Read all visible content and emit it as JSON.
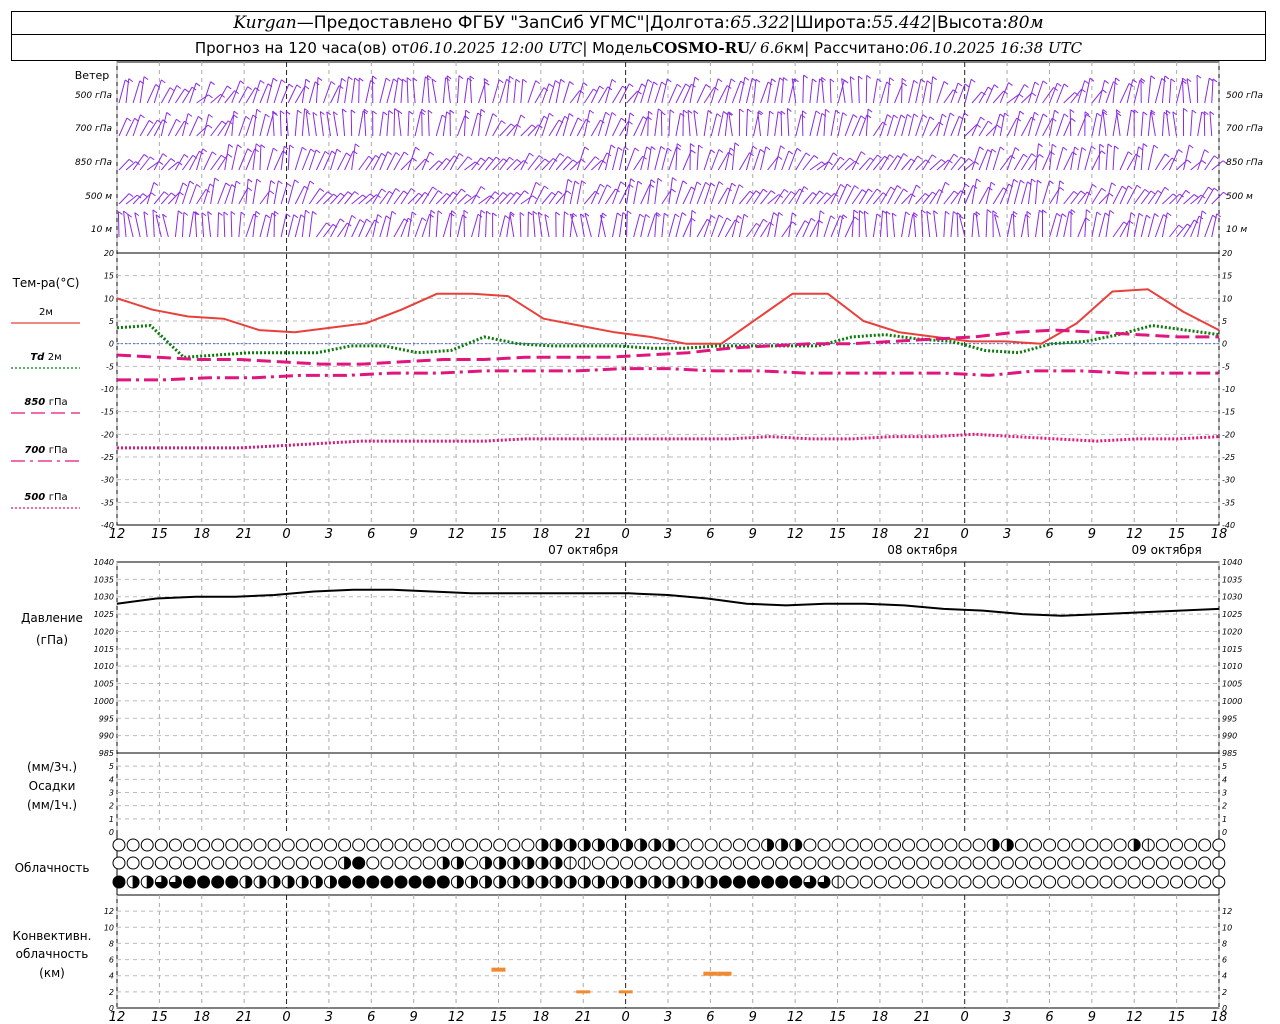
{
  "header": {
    "station": "Kurgan",
    "dash": " — ",
    "provider": "Предоставлено ФГБУ \"ЗапСиб УГМС\"",
    "sep": " | ",
    "lon_label": "Долгота: ",
    "lon_value": "65.322",
    "lat_label": "Широта: ",
    "lat_value": "55.442",
    "alt_label": "Высота: ",
    "alt_value": "80м",
    "forecast_label": "Прогноз на 120 часа(ов) от ",
    "forecast_time": "06.10.2025 12:00 UTC",
    "model_label": " | Модель ",
    "model_name": "COSMO-RU",
    "model_res": " / 6.6",
    "model_res_unit": "км",
    "calc_label": " | Рассчитано: ",
    "calc_time": "06.10.2025 16:38 UTC"
  },
  "wind_panel": {
    "title": "Ветер",
    "levels": [
      "500 гПа",
      "700 гПа",
      "850 гПа",
      "500 м",
      "10 м"
    ],
    "color": "#8a2be2"
  },
  "temp_panel": {
    "title": "Тем-ра(°С)",
    "legend": [
      {
        "label": "2м",
        "italic_prefix": "",
        "color": "#e8403a",
        "style": "solid"
      },
      {
        "label": "2м",
        "italic_prefix": "Td",
        "color": "#0a7a0a",
        "style": "dotted"
      },
      {
        "label": "гПа",
        "italic_prefix": "850",
        "color": "#e0157e",
        "style": "dashed"
      },
      {
        "label": "гПа",
        "italic_prefix": "700",
        "color": "#e0157e",
        "style": "dashdot"
      },
      {
        "label": "гПа",
        "italic_prefix": "500",
        "color": "#e0157e",
        "style": "dotted"
      }
    ],
    "yticks": [
      "20",
      "15",
      "10",
      "5",
      "0",
      "-5",
      "-10",
      "-15",
      "-20",
      "-25",
      "-30",
      "-35",
      "-40"
    ]
  },
  "pressure_panel": {
    "title1": "Давление",
    "title2": "(гПа)",
    "yticks": [
      "1040",
      "1035",
      "1030",
      "1025",
      "1020",
      "1015",
      "1010",
      "1005",
      "1000",
      "995",
      "990",
      "985"
    ]
  },
  "precip_panel": {
    "title1": "(мм/3ч.)",
    "title2": "Осадки",
    "title3": "(мм/1ч.)",
    "yticks": [
      "5",
      "4",
      "3",
      "2",
      "1",
      "0"
    ]
  },
  "cloud_panel": {
    "title": "Облачность"
  },
  "conv_panel": {
    "title1": "Конвективн.",
    "title2": "облачность",
    "title3": "(км)",
    "yticks": [
      "12",
      "10",
      "8",
      "6",
      "4",
      "2",
      "0"
    ],
    "color": "#f08a30"
  },
  "time_axis": {
    "hour_labels": [
      "12",
      "15",
      "18",
      "21",
      "0",
      "3",
      "6",
      "9",
      "12",
      "15",
      "18",
      "21",
      "0",
      "3",
      "6",
      "9",
      "12",
      "15",
      "18",
      "21",
      "0",
      "3",
      "6",
      "9",
      "12",
      "15",
      "18"
    ],
    "day_labels": [
      "07 октября",
      "08 октября",
      "09 октября"
    ]
  },
  "chart_data": {
    "type": "line",
    "x_hours_from_start": [
      0,
      3,
      6,
      9,
      12,
      15,
      18,
      21,
      24,
      27,
      30,
      33,
      36,
      39,
      42,
      45,
      48,
      51,
      54,
      57,
      60,
      63,
      66,
      69,
      72,
      75,
      78
    ],
    "series": [
      {
        "name": "2м",
        "values": [
          10,
          7.5,
          6,
          5.5,
          3,
          2.5,
          3.5,
          4.5,
          7.5,
          11,
          11,
          10.5,
          5.5,
          4,
          2.5,
          1.5,
          0,
          0,
          5.5,
          11,
          11,
          5,
          2.5,
          1.5,
          0.5,
          0.5,
          0,
          4.5,
          11.5,
          12,
          7,
          3
        ]
      },
      {
        "name": "Td 2м",
        "values": [
          3.5,
          4,
          -3,
          -2.5,
          -2,
          -2,
          -2,
          -0.5,
          -0.5,
          -2,
          -1.5,
          1.5,
          0,
          -0.5,
          -0.5,
          -0.5,
          -1,
          -1,
          -0.5,
          -0.5,
          -0.5,
          -0.5,
          1.5,
          2,
          1,
          0.5,
          -1.5,
          -2,
          0,
          0.5,
          2,
          4,
          3,
          2
        ]
      },
      {
        "name": "850 гПа",
        "values": [
          -2.5,
          -3,
          -3.5,
          -3.5,
          -4,
          -4.5,
          -4.5,
          -4,
          -3.5,
          -3.5,
          -3,
          -3,
          -3,
          -2.5,
          -2,
          -1,
          -0.5,
          0,
          0,
          0.5,
          1,
          1.5,
          2.5,
          3,
          2.5,
          2,
          1.5,
          1.5
        ]
      },
      {
        "name": "700 гПа",
        "values": [
          -8,
          -8,
          -7.5,
          -7.5,
          -7,
          -7,
          -6.5,
          -6.5,
          -6,
          -6,
          -6,
          -5.5,
          -5.5,
          -6,
          -6,
          -6.5,
          -6.5,
          -6.5,
          -6.5,
          -7,
          -6,
          -6,
          -6.5,
          -6.5,
          -6.5
        ]
      },
      {
        "name": "500 гПа",
        "values": [
          -23,
          -23,
          -23,
          -23,
          -22.5,
          -22,
          -21.5,
          -21.5,
          -21.5,
          -21.5,
          -21,
          -21,
          -21,
          -21,
          -21,
          -21,
          -20.5,
          -21,
          -21,
          -20.5,
          -20.5,
          -20,
          -20.5,
          -21,
          -21.5,
          -21,
          -21,
          -20.5
        ]
      }
    ],
    "pressure": {
      "name": "Давление",
      "values": [
        1028,
        1029.5,
        1030,
        1030,
        1030.5,
        1031.5,
        1032,
        1032,
        1031.5,
        1031,
        1031,
        1031,
        1031,
        1031,
        1030.5,
        1029.5,
        1028,
        1027.5,
        1028,
        1028,
        1027.5,
        1026.5,
        1026,
        1025,
        1024.5,
        1025,
        1025.5,
        1026,
        1026.5
      ]
    },
    "convective_cloud_km": [
      {
        "hour": 27,
        "base": 4.5,
        "top": 5.0
      },
      {
        "hour": 33,
        "base": 2.0,
        "top": 2.0
      },
      {
        "hour": 36,
        "base": 2.0,
        "top": 2.0
      },
      {
        "hour": 42,
        "base": 4.0,
        "top": 4.5
      },
      {
        "hour": 43,
        "base": 4.0,
        "top": 4.5
      }
    ],
    "cloud_cover_eighths": {
      "upper": [
        0,
        0,
        0,
        0,
        0,
        0,
        0,
        0,
        0,
        0,
        0,
        0,
        0,
        0,
        0,
        0,
        0,
        0,
        0,
        0,
        0,
        0,
        0,
        0,
        0,
        0,
        0,
        0,
        0,
        0,
        4,
        4,
        4,
        4,
        4,
        4,
        4,
        4,
        4,
        4,
        0,
        0,
        0,
        0,
        0,
        0,
        4,
        4,
        4,
        0,
        0,
        0,
        0,
        0,
        0,
        0,
        0,
        0,
        0,
        0,
        0,
        0,
        4,
        4,
        0,
        0,
        0,
        0,
        0,
        0,
        0,
        0,
        4,
        2,
        0,
        0,
        0,
        0,
        0,
        0,
        4,
        4,
        0,
        0,
        0,
        0,
        0,
        0,
        0,
        0,
        0,
        0,
        0,
        0,
        0,
        0,
        0,
        0,
        0,
        0,
        0,
        0,
        0,
        0,
        0,
        0,
        0,
        0,
        0,
        0,
        4,
        4,
        4,
        4,
        4,
        4,
        2,
        0
      ],
      "middle": [
        0,
        0,
        0,
        0,
        0,
        0,
        0,
        0,
        0,
        0,
        0,
        0,
        0,
        0,
        0,
        0,
        4,
        8,
        0,
        0,
        0,
        0,
        0,
        4,
        4,
        0,
        4,
        4,
        4,
        4,
        4,
        4,
        2,
        2,
        0,
        0,
        0,
        0,
        0,
        0,
        0,
        0,
        0,
        0,
        0,
        0,
        0,
        0,
        0,
        0,
        0,
        0,
        0,
        0,
        0,
        0,
        0,
        0,
        0,
        0,
        0,
        0,
        0,
        0,
        0,
        0,
        0,
        0,
        0,
        0,
        0,
        0,
        0,
        0,
        0,
        0,
        0,
        0,
        0,
        0,
        0,
        0,
        0,
        0,
        0,
        0,
        0,
        0,
        0,
        0,
        0,
        0,
        0,
        0,
        0,
        0,
        0,
        0,
        0,
        0,
        0,
        0,
        0,
        0,
        0,
        0,
        4,
        4,
        2,
        2,
        4,
        4,
        4,
        6,
        8,
        8,
        8
      ],
      "lower": [
        8,
        4,
        4,
        6,
        6,
        8,
        8,
        8,
        8,
        4,
        4,
        4,
        4,
        4,
        4,
        4,
        8,
        8,
        8,
        8,
        8,
        8,
        8,
        8,
        4,
        4,
        4,
        4,
        4,
        4,
        4,
        4,
        4,
        4,
        4,
        4,
        4,
        4,
        4,
        4,
        4,
        4,
        4,
        8,
        8,
        8,
        8,
        8,
        8,
        6,
        6,
        2,
        0,
        0,
        0,
        0,
        0,
        0,
        0,
        0,
        0,
        0,
        0,
        0,
        0,
        0,
        0,
        0,
        0,
        0,
        0,
        0,
        0,
        0,
        0,
        0,
        0,
        0,
        0,
        0,
        0,
        0,
        0,
        0,
        0,
        0,
        0,
        0,
        0,
        0,
        0,
        0,
        0,
        0,
        0,
        0,
        0,
        0,
        0,
        0,
        0,
        0,
        0,
        0,
        0,
        0,
        0,
        0,
        0,
        0,
        0,
        0,
        0,
        0,
        0,
        0,
        0,
        0,
        0,
        0
      ]
    }
  }
}
